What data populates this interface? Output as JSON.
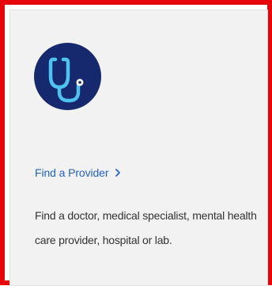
{
  "card": {
    "icon": "stethoscope-icon",
    "link_label": "Find a Provider",
    "link_chevron": "chevron-right-icon",
    "description": "Find a doctor, medical specialist, mental health care provider, hospital or lab."
  },
  "colors": {
    "frame_border": "#e8050a",
    "card_background": "#f2f2f2",
    "icon_background": "#16286e",
    "icon_stroke": "#4fc3f0",
    "link": "#2464c8",
    "body_text": "#333333"
  }
}
